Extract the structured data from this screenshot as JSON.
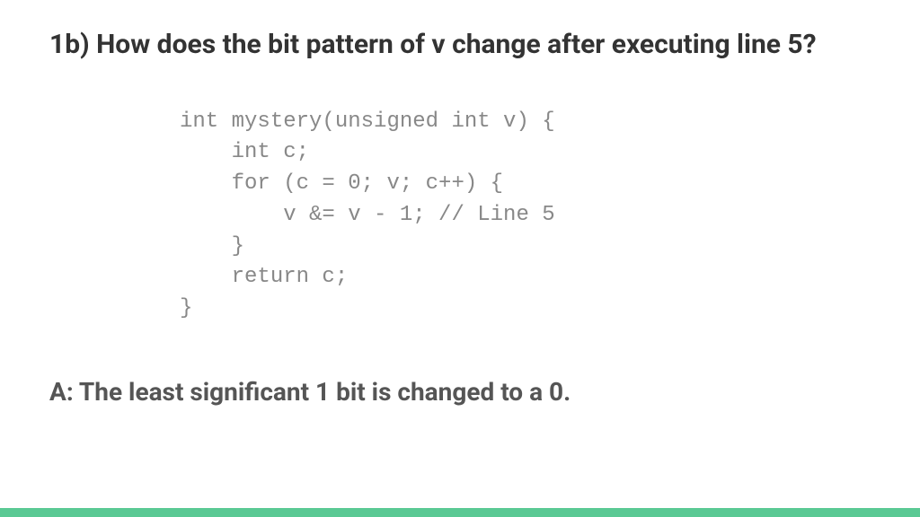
{
  "question": "1b) How does the bit pattern of v change after executing line 5?",
  "code": "int mystery(unsigned int v) {\n    int c;\n    for (c = 0; v; c++) {\n        v &= v - 1; // Line 5\n    }\n    return c;\n}",
  "answer": "A: The least significant 1 bit is changed to a 0.",
  "accent_color": "#5ac994"
}
